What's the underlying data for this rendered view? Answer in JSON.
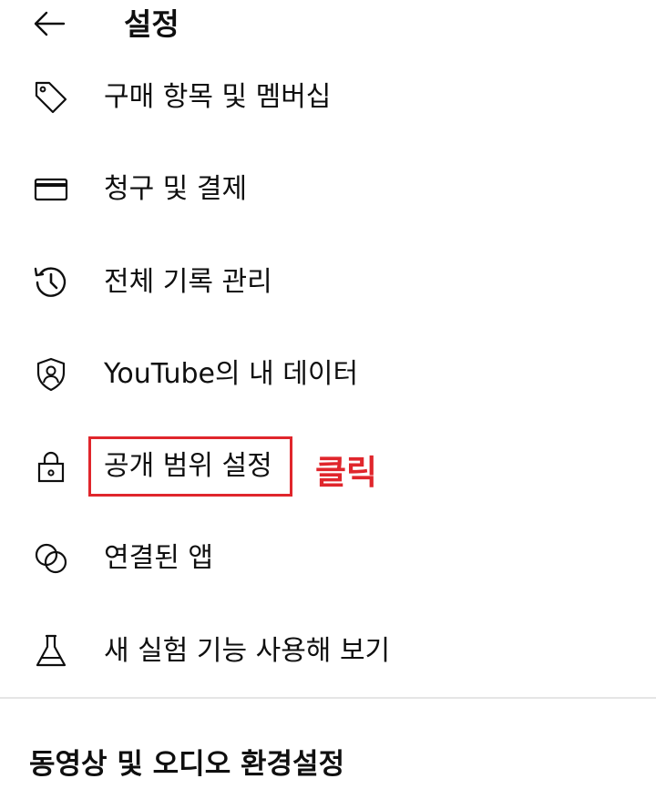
{
  "header": {
    "title": "설정"
  },
  "menu": {
    "items": [
      {
        "label": "구매 항목 및 멤버십",
        "icon": "tag-icon"
      },
      {
        "label": "청구 및 결제",
        "icon": "credit-card-icon"
      },
      {
        "label": "전체 기록 관리",
        "icon": "history-icon"
      },
      {
        "label": "YouTube의 내 데이터",
        "icon": "shield-person-icon"
      },
      {
        "label": "공개 범위 설정",
        "icon": "lock-icon"
      },
      {
        "label": "연결된 앱",
        "icon": "linked-circles-icon"
      },
      {
        "label": "새 실험 기능 사용해 보기",
        "icon": "flask-icon"
      }
    ]
  },
  "annotation": {
    "text": "클릭",
    "color": "#e0262c"
  },
  "section": {
    "title": "동영상 및 오디오 환경설정"
  }
}
